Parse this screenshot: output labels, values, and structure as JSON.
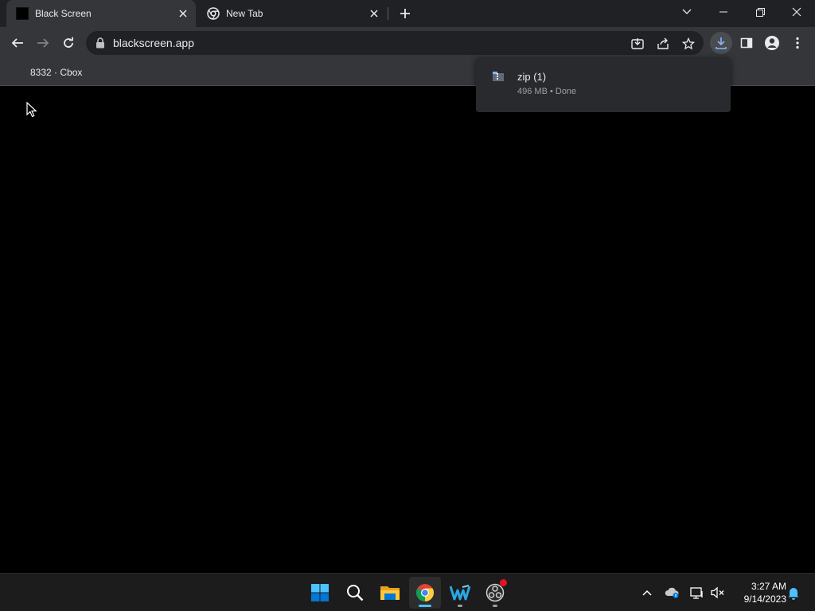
{
  "browser": {
    "tabs": [
      {
        "title": "Black Screen",
        "active": true,
        "favicon": "black-square-icon"
      },
      {
        "title": "New Tab",
        "active": false,
        "favicon": "chrome-icon"
      }
    ],
    "url": "blackscreen.app",
    "bookmarks": [
      {
        "label": "8332 · Cbox"
      }
    ]
  },
  "downloads": {
    "items": [
      {
        "name": "zip (1)",
        "status": "496 MB • Done"
      }
    ]
  },
  "taskbar": {
    "apps": [
      {
        "name": "start-button",
        "icon": "windows-logo-icon"
      },
      {
        "name": "search",
        "icon": "search-icon"
      },
      {
        "name": "file-explorer",
        "icon": "folder-icon"
      },
      {
        "name": "chrome",
        "icon": "chrome-icon",
        "active": true
      },
      {
        "name": "app-w",
        "icon": "w-app-icon"
      },
      {
        "name": "obs",
        "icon": "obs-icon"
      }
    ],
    "clock": {
      "time": "3:27 AM",
      "date": "9/14/2023"
    }
  },
  "colors": {
    "tab_active": "#35363a",
    "tabstrip": "#202124",
    "accent": "#8ab4f8",
    "taskbar": "#1c1c1c"
  }
}
